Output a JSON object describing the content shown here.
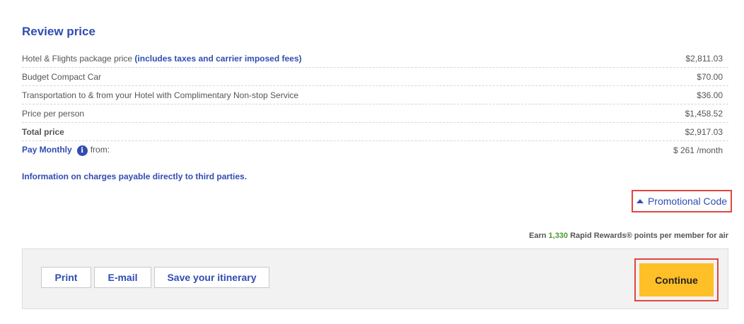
{
  "review": {
    "title": "Review price",
    "rows": [
      {
        "label": "Hotel & Flights  package price",
        "highlight": "(includes taxes and carrier imposed fees)",
        "amount": "$2,811.03"
      },
      {
        "label": "Budget Compact Car",
        "amount": "$70.00"
      },
      {
        "label": "Transportation to & from your Hotel with Complimentary Non-stop Service",
        "amount": "$36.00"
      },
      {
        "label": "Price per person",
        "amount": "$1,458.52"
      },
      {
        "label": "Total price",
        "amount": "$2,917.03"
      }
    ],
    "pay_monthly": {
      "link": "Pay Monthly",
      "info_icon": "i",
      "from": "from:",
      "amount": "$ 261 /month"
    },
    "third_party_link": "Information on charges payable directly to third parties."
  },
  "promo": {
    "label": "Promotional Code",
    "icon": "caret-up-icon"
  },
  "earn": {
    "prefix": "Earn",
    "points": "1,330",
    "suffix": "Rapid Rewards® points per member for air"
  },
  "actions": {
    "print": "Print",
    "email": "E-mail",
    "save": "Save your itinerary",
    "continue": "Continue"
  },
  "colors": {
    "accent": "#304cb2",
    "continue_bg": "#ffbf27",
    "highlight_border": "#e0463f",
    "points": "#4a9a2e"
  }
}
